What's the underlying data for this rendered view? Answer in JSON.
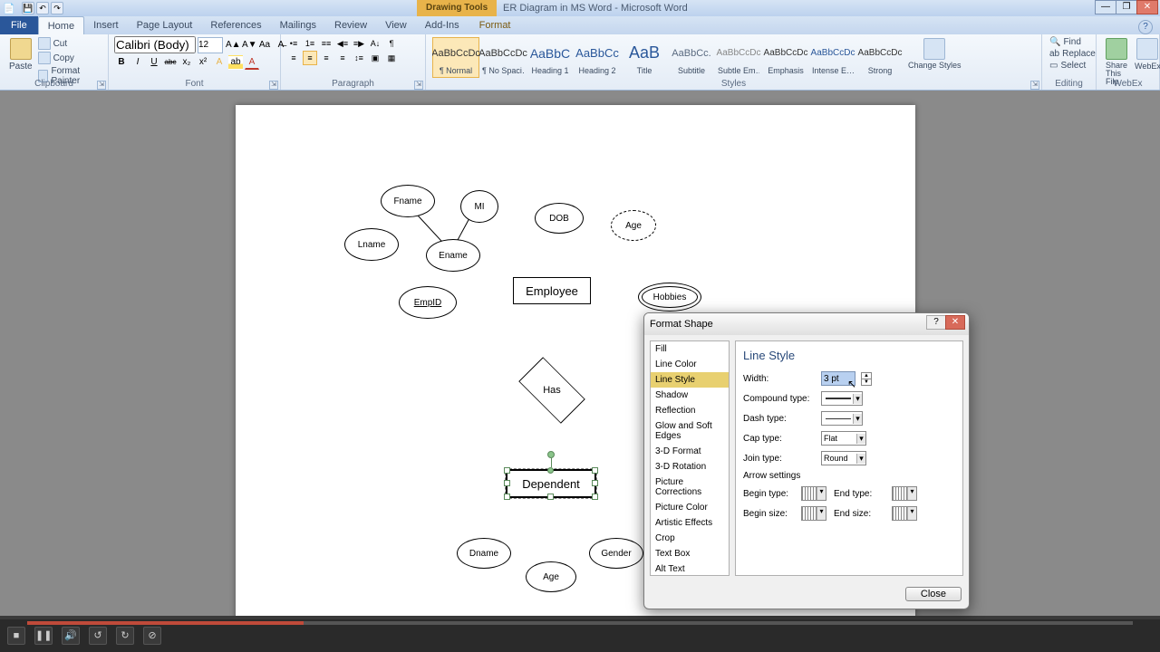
{
  "app": {
    "doc_title": "ER Diagram in MS Word - Microsoft Word",
    "drawing_tools": "Drawing Tools"
  },
  "qat": {
    "save": "💾",
    "undo": "↶",
    "redo": "↷"
  },
  "win": {
    "min": "—",
    "max": "❐",
    "close": "✕",
    "help": "?"
  },
  "tabs": {
    "file": "File",
    "home": "Home",
    "insert": "Insert",
    "pagelayout": "Page Layout",
    "references": "References",
    "mailings": "Mailings",
    "review": "Review",
    "view": "View",
    "addins": "Add-Ins",
    "format": "Format"
  },
  "clipboard": {
    "paste": "Paste",
    "cut": "Cut",
    "copy": "Copy",
    "painter": "Format Painter",
    "label": "Clipboard"
  },
  "font": {
    "name": "Calibri (Body)",
    "size": "12",
    "label": "Font",
    "bold": "B",
    "italic": "I",
    "underline": "U",
    "strike": "abc",
    "sub": "x₂",
    "sup": "x²",
    "case": "Aa",
    "clear": "A"
  },
  "paragraph": {
    "label": "Paragraph"
  },
  "styles": {
    "label": "Styles",
    "change": "Change Styles",
    "items": [
      {
        "preview": "AaBbCcDc",
        "name": "¶ Normal",
        "color": "#333",
        "size": "11px"
      },
      {
        "preview": "AaBbCcDc",
        "name": "¶ No Spaci…",
        "color": "#333",
        "size": "11px"
      },
      {
        "preview": "AaBbC",
        "name": "Heading 1",
        "color": "#2a579a",
        "size": "14px"
      },
      {
        "preview": "AaBbCc",
        "name": "Heading 2",
        "color": "#2a579a",
        "size": "13px"
      },
      {
        "preview": "AaB",
        "name": "Title",
        "color": "#2a579a",
        "size": "18px"
      },
      {
        "preview": "AaBbCc.",
        "name": "Subtitle",
        "color": "#5a6a80",
        "size": "11px"
      },
      {
        "preview": "AaBbCcDc",
        "name": "Subtle Em…",
        "color": "#888",
        "size": "10px"
      },
      {
        "preview": "AaBbCcDc",
        "name": "Emphasis",
        "color": "#333",
        "size": "10px"
      },
      {
        "preview": "AaBbCcDc",
        "name": "Intense E…",
        "color": "#2a579a",
        "size": "10px"
      },
      {
        "preview": "AaBbCcDc",
        "name": "Strong",
        "color": "#333",
        "size": "10px"
      }
    ]
  },
  "editing": {
    "find": "Find",
    "replace": "Replace",
    "select": "Select",
    "label": "Editing"
  },
  "webex": {
    "share": "Share This File",
    "ext": "WebEx",
    "label": "WebEx"
  },
  "er": {
    "employee": "Employee",
    "dependent": "Dependent",
    "has": "Has",
    "fname": "Fname",
    "mi": "MI",
    "lname": "Lname",
    "ename": "Ename",
    "dob": "DOB",
    "age": "Age",
    "hobbies": "Hobbies",
    "empid": "EmpID",
    "dname": "Dname",
    "gender": "Gender",
    "age2": "Age"
  },
  "dialog": {
    "title": "Format Shape",
    "close_btn": "Close",
    "categories": [
      "Fill",
      "Line Color",
      "Line Style",
      "Shadow",
      "Reflection",
      "Glow and Soft Edges",
      "3-D Format",
      "3-D Rotation",
      "Picture Corrections",
      "Picture Color",
      "Artistic Effects",
      "Crop",
      "Text Box",
      "Alt Text"
    ],
    "selected_cat": 2,
    "panel_title": "Line Style",
    "width_lbl": "Width:",
    "width_val": "3 pt",
    "compound_lbl": "Compound type:",
    "dash_lbl": "Dash type:",
    "cap_lbl": "Cap type:",
    "cap_val": "Flat",
    "join_lbl": "Join type:",
    "join_val": "Round",
    "arrow_hdr": "Arrow settings",
    "begin_type": "Begin type:",
    "end_type": "End type:",
    "begin_size": "Begin size:",
    "end_size": "End size:"
  }
}
